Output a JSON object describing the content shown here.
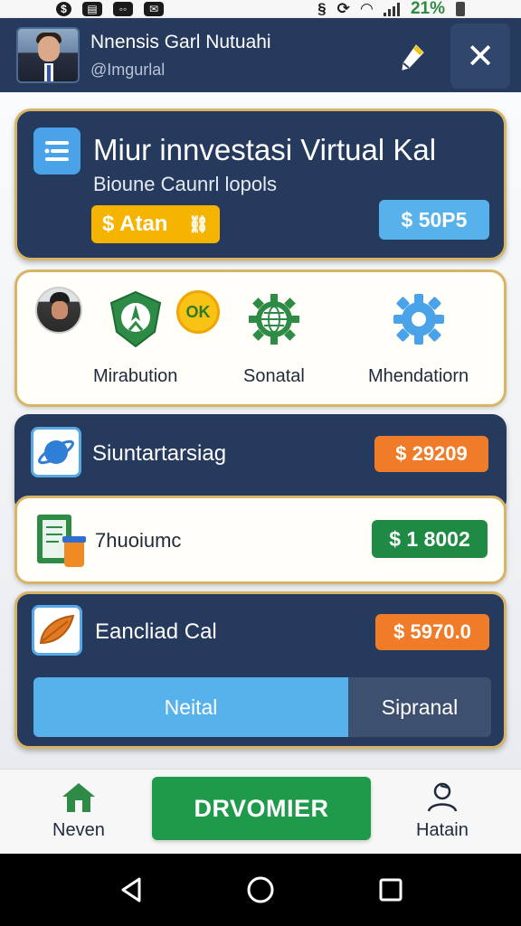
{
  "status_bar": {
    "icons": [
      "dollar-icon",
      "doc-icon",
      "media-icon",
      "chat-icon"
    ],
    "battery": "21%"
  },
  "header": {
    "user_name": "Nnensis Garl Nutuahi",
    "user_handle": "@Imgurlal",
    "edit_icon": "pen-icon",
    "close_icon": "close-icon"
  },
  "hero": {
    "title": "Miur innvestasi Virtual Kal",
    "subtitle": "Bioune Caunrl lopols",
    "button_label": "$ Atan",
    "badge": "$ 50P5",
    "icon": "list-icon"
  },
  "shortcuts": {
    "items": [
      {
        "label": "Mirabution",
        "icon": "leaf-shield-icon"
      },
      {
        "label": "Sonatal",
        "icon": "gear-globe-icon"
      },
      {
        "label": "Mhendatiorn",
        "icon": "settings-gear-icon"
      }
    ],
    "ok_badge": "OK"
  },
  "rows": [
    {
      "title": "Siuntartarsiag",
      "amount": "$ 29209",
      "icon": "planet-icon"
    },
    {
      "title": "7huoiumc",
      "amount": "$ 1 8002",
      "icon": "document-jar-icon"
    },
    {
      "title": "Eancliad Cal",
      "amount": "$ 5970.0",
      "icon": "leaf-icon"
    }
  ],
  "segmented": {
    "active": "Neital",
    "inactive": "Sipranal"
  },
  "bottom_nav": {
    "left_label": "Neven",
    "primary": "DRVOMIER",
    "right_label": "Hatain"
  },
  "colors": {
    "navy": "#263a5e",
    "gold_border": "#d8b465",
    "orange": "#f07c2a",
    "green": "#1f8a43",
    "blue": "#57b2ec",
    "yellow": "#f4b400"
  }
}
